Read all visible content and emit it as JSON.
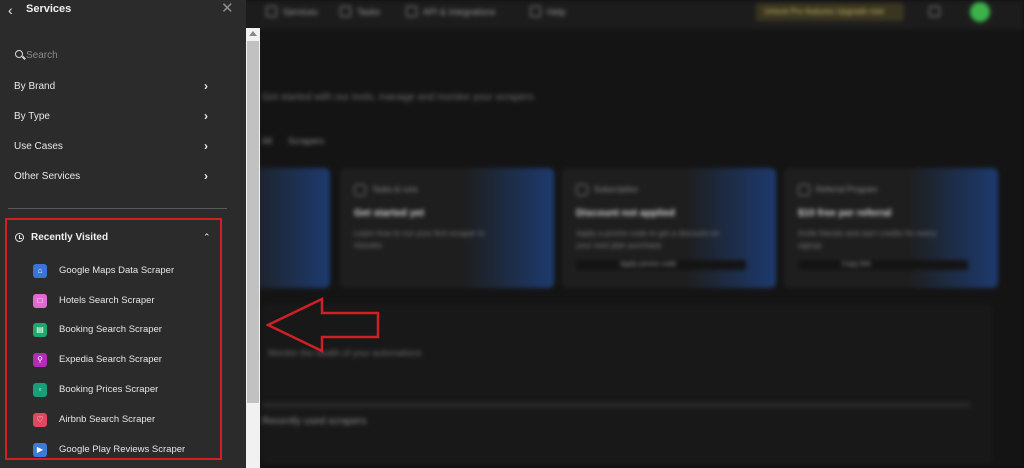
{
  "background": {
    "nav": [
      "Services",
      "Tasks",
      "API & Integrations",
      "Help"
    ],
    "promo": "Unlock Pro features Upgrade now",
    "subtitle": "Get started with our tools, manage and monitor your scrapers",
    "tabs": [
      "All",
      "Scrapers"
    ],
    "cards": [
      {
        "tag": "",
        "title": "",
        "desc": "",
        "foot": ""
      },
      {
        "tag": "Tasks & runs",
        "title": "Get started yet",
        "desc": "Learn how to run your first scraper in minutes",
        "foot": ""
      },
      {
        "tag": "Subscription",
        "title": "Discount not applied",
        "desc": "Apply a promo code to get a discount on your next plan purchase",
        "foot": "Apply promo code"
      },
      {
        "tag": "Referral Program",
        "title": "$10 free per referral",
        "desc": "Invite friends and earn credits for every signup",
        "foot": "Copy link"
      }
    ],
    "panel_text": "Monitor the health of your automations",
    "panel_title": "Recently used scrapers"
  },
  "drawer": {
    "title": "Services",
    "search_placeholder": "Search",
    "items": [
      {
        "label": "By Brand"
      },
      {
        "label": "By Type"
      },
      {
        "label": "Use Cases"
      },
      {
        "label": "Other Services"
      }
    ],
    "recent": {
      "title": "Recently Visited",
      "items": [
        {
          "label": "Google Maps Data Scraper",
          "icon": "map-pin-icon",
          "color": "#3b74d6"
        },
        {
          "label": "Hotels Search Scraper",
          "icon": "hotel-icon",
          "color": "#e06bd0"
        },
        {
          "label": "Booking Search Scraper",
          "icon": "booking-icon",
          "color": "#1fa86b"
        },
        {
          "label": "Expedia Search Scraper",
          "icon": "expedia-icon",
          "color": "#b52ab8"
        },
        {
          "label": "Booking Prices Scraper",
          "icon": "price-tag-icon",
          "color": "#1a9e7a"
        },
        {
          "label": "Airbnb Search Scraper",
          "icon": "airbnb-icon",
          "color": "#e0485f"
        },
        {
          "label": "Google Play Reviews Scraper",
          "icon": "play-icon",
          "color": "#3a7bd8"
        }
      ]
    }
  },
  "colors": {
    "highlight": "#d11f26",
    "drawer_bg": "#2b2b2b"
  }
}
